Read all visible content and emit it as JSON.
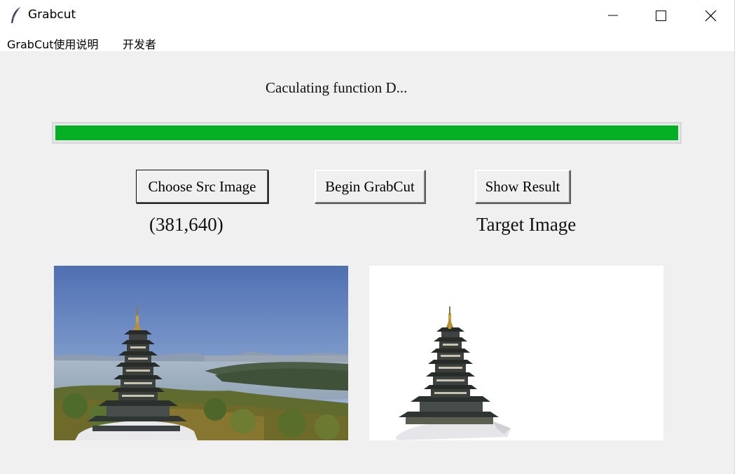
{
  "window": {
    "title": "Grabcut",
    "app_icon": "feather-icon",
    "controls": [
      "minimize-icon",
      "maximize-icon",
      "close-icon"
    ]
  },
  "menu": {
    "items": [
      "GrabCut使用说明",
      "开发者"
    ]
  },
  "status": {
    "text": "Caculating function D..."
  },
  "progress": {
    "fraction": 1.0,
    "color": "#06b025"
  },
  "buttons": {
    "choose_src": "Choose Src Image",
    "begin_grabcut": "Begin GrabCut",
    "show_result": "Show Result"
  },
  "labels": {
    "src_dims": "(381,640)",
    "target": "Target Image"
  },
  "images": {
    "source": "pagoda-lake-photo",
    "target": "pagoda-cutout-on-white"
  }
}
